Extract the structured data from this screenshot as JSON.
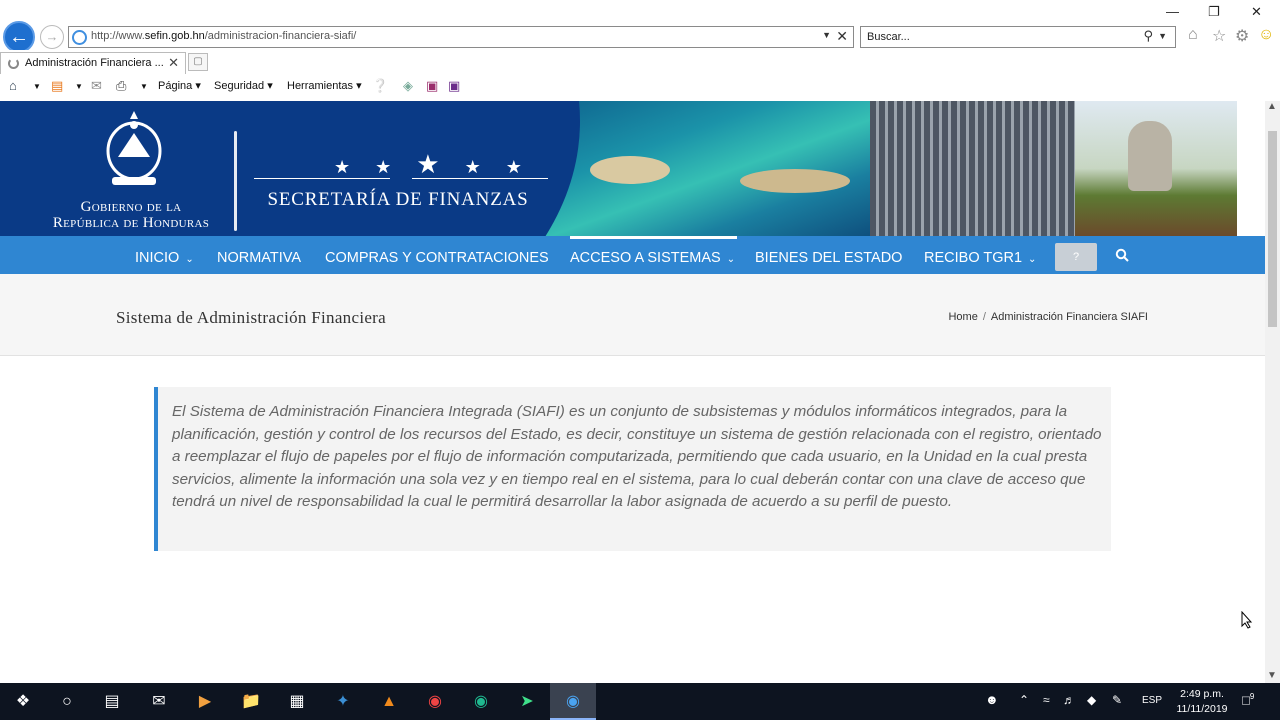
{
  "browser": {
    "url_prefix": "http://www.",
    "url_domain": "sefin.gob.hn",
    "url_path": "/administracion-financiera-siafi/",
    "search_placeholder": "Buscar...",
    "tab_title": "Administración Financiera ...",
    "commands": {
      "page": "Página",
      "security": "Seguridad",
      "tools": "Herramientas"
    }
  },
  "header": {
    "gov_line1": "Gobierno de la",
    "gov_line2": "República de Honduras",
    "stars": "★ ★",
    "star_big": "★",
    "stars_right": "★ ★",
    "secretariat": "SECRETARÍA DE FINANZAS"
  },
  "nav": {
    "items": [
      {
        "label": "INICIO",
        "chevron": "⌄"
      },
      {
        "label": "NORMATIVA"
      },
      {
        "label": "COMPRAS Y CONTRATACIONES"
      },
      {
        "label": "ACCESO A SISTEMAS",
        "chevron": "⌄"
      },
      {
        "label": "BIENES DEL ESTADO"
      },
      {
        "label": "RECIBO TGR1",
        "chevron": "⌄"
      }
    ],
    "help_label": "?"
  },
  "page": {
    "title": "Sistema de Administración Financiera",
    "breadcrumb_home": "Home",
    "breadcrumb_sep": "/",
    "breadcrumb_current": "Administración Financiera SIAFI",
    "quote": "El Sistema de Administración Financiera Integrada (SIAFI) es un conjunto de subsistemas y módulos informáticos integrados, para la planificación, gestión y control de los recursos del Estado, es decir, constituye un sistema de gestión relacionada con el registro, orientado a reemplazar el flujo de papeles por el flujo de información computarizada, permitiendo que cada usuario, en la Unidad en la cual presta servicios, alimente la información una sola vez y en tiempo real en el sistema, para lo cual deberán contar con una clave de acceso que tendrá un nivel de responsabilidad la cual le permitirá desarrollar la labor asignada de acuerdo a su perfil de puesto."
  },
  "taskbar": {
    "language": "ESP",
    "time": "2:49 p.m.",
    "date": "11/11/2019",
    "notifications": "9"
  },
  "colors": {
    "nav_blue": "#2f86d2",
    "banner_navy": "#0a2d6e",
    "quote_border": "#2f86d2"
  }
}
